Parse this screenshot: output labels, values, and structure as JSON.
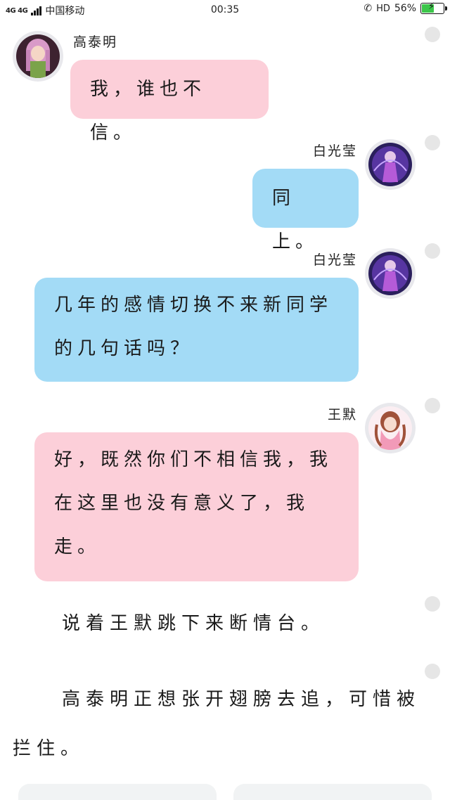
{
  "status_bar": {
    "network": "4G 4G",
    "carrier": "中国移动",
    "time": "00:35",
    "hd": "HD",
    "battery_percent": "56%",
    "battery_level": 0.56
  },
  "messages": [
    {
      "sender": "高泰明",
      "side": "left",
      "color": "pink",
      "text": "我，谁也不信。"
    },
    {
      "sender": "白光莹",
      "side": "right",
      "color": "blue",
      "text": "同上。"
    },
    {
      "sender": "白光莹",
      "side": "right",
      "color": "blue",
      "lines": [
        "几年的感情切换不来新同学",
        "的几句话吗？"
      ]
    },
    {
      "sender": "王默",
      "side": "right",
      "color": "pink",
      "lines": [
        "好，既然你们不相信我，我",
        "在这里也没有意义了，我",
        "走。"
      ]
    }
  ],
  "narration": [
    {
      "text": "说着王默跳下来断情台。"
    },
    {
      "lines": [
        "高泰明正想张开翅膀去追，可惜被",
        "拦住。"
      ]
    }
  ],
  "colors": {
    "pink_bubble": "#fccfd9",
    "blue_bubble": "#a3dbf6",
    "battery_green": "#3cc64a"
  }
}
